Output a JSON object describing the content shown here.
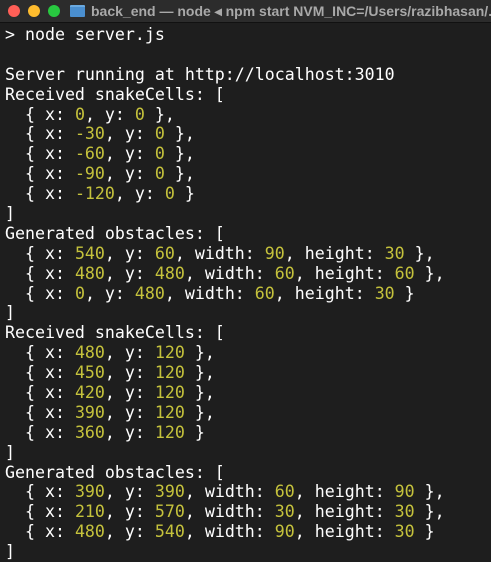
{
  "window": {
    "title": "back_end — node ◂ npm start NVM_INC=/Users/razibhasan/.nvm"
  },
  "colors": {
    "number": "#c5c23c",
    "text": "#ffffff",
    "background": "#1e1e1e"
  },
  "terminal": {
    "lines": [
      [
        {
          "t": "> node server.js"
        }
      ],
      [],
      [
        {
          "t": "Server running at http://localhost:3010"
        }
      ],
      [
        {
          "t": "Received snakeCells: ["
        }
      ],
      [
        {
          "t": "  { x: "
        },
        {
          "t": "0",
          "n": 1
        },
        {
          "t": ", y: "
        },
        {
          "t": "0",
          "n": 1
        },
        {
          "t": " },"
        }
      ],
      [
        {
          "t": "  { x: "
        },
        {
          "t": "-30",
          "n": 1
        },
        {
          "t": ", y: "
        },
        {
          "t": "0",
          "n": 1
        },
        {
          "t": " },"
        }
      ],
      [
        {
          "t": "  { x: "
        },
        {
          "t": "-60",
          "n": 1
        },
        {
          "t": ", y: "
        },
        {
          "t": "0",
          "n": 1
        },
        {
          "t": " },"
        }
      ],
      [
        {
          "t": "  { x: "
        },
        {
          "t": "-90",
          "n": 1
        },
        {
          "t": ", y: "
        },
        {
          "t": "0",
          "n": 1
        },
        {
          "t": " },"
        }
      ],
      [
        {
          "t": "  { x: "
        },
        {
          "t": "-120",
          "n": 1
        },
        {
          "t": ", y: "
        },
        {
          "t": "0",
          "n": 1
        },
        {
          "t": " }"
        }
      ],
      [
        {
          "t": "]"
        }
      ],
      [
        {
          "t": "Generated obstacles: ["
        }
      ],
      [
        {
          "t": "  { x: "
        },
        {
          "t": "540",
          "n": 1
        },
        {
          "t": ", y: "
        },
        {
          "t": "60",
          "n": 1
        },
        {
          "t": ", width: "
        },
        {
          "t": "90",
          "n": 1
        },
        {
          "t": ", height: "
        },
        {
          "t": "30",
          "n": 1
        },
        {
          "t": " },"
        }
      ],
      [
        {
          "t": "  { x: "
        },
        {
          "t": "480",
          "n": 1
        },
        {
          "t": ", y: "
        },
        {
          "t": "480",
          "n": 1
        },
        {
          "t": ", width: "
        },
        {
          "t": "60",
          "n": 1
        },
        {
          "t": ", height: "
        },
        {
          "t": "60",
          "n": 1
        },
        {
          "t": " },"
        }
      ],
      [
        {
          "t": "  { x: "
        },
        {
          "t": "0",
          "n": 1
        },
        {
          "t": ", y: "
        },
        {
          "t": "480",
          "n": 1
        },
        {
          "t": ", width: "
        },
        {
          "t": "60",
          "n": 1
        },
        {
          "t": ", height: "
        },
        {
          "t": "30",
          "n": 1
        },
        {
          "t": " }"
        }
      ],
      [
        {
          "t": "]"
        }
      ],
      [
        {
          "t": "Received snakeCells: ["
        }
      ],
      [
        {
          "t": "  { x: "
        },
        {
          "t": "480",
          "n": 1
        },
        {
          "t": ", y: "
        },
        {
          "t": "120",
          "n": 1
        },
        {
          "t": " },"
        }
      ],
      [
        {
          "t": "  { x: "
        },
        {
          "t": "450",
          "n": 1
        },
        {
          "t": ", y: "
        },
        {
          "t": "120",
          "n": 1
        },
        {
          "t": " },"
        }
      ],
      [
        {
          "t": "  { x: "
        },
        {
          "t": "420",
          "n": 1
        },
        {
          "t": ", y: "
        },
        {
          "t": "120",
          "n": 1
        },
        {
          "t": " },"
        }
      ],
      [
        {
          "t": "  { x: "
        },
        {
          "t": "390",
          "n": 1
        },
        {
          "t": ", y: "
        },
        {
          "t": "120",
          "n": 1
        },
        {
          "t": " },"
        }
      ],
      [
        {
          "t": "  { x: "
        },
        {
          "t": "360",
          "n": 1
        },
        {
          "t": ", y: "
        },
        {
          "t": "120",
          "n": 1
        },
        {
          "t": " }"
        }
      ],
      [
        {
          "t": "]"
        }
      ],
      [
        {
          "t": "Generated obstacles: ["
        }
      ],
      [
        {
          "t": "  { x: "
        },
        {
          "t": "390",
          "n": 1
        },
        {
          "t": ", y: "
        },
        {
          "t": "390",
          "n": 1
        },
        {
          "t": ", width: "
        },
        {
          "t": "60",
          "n": 1
        },
        {
          "t": ", height: "
        },
        {
          "t": "90",
          "n": 1
        },
        {
          "t": " },"
        }
      ],
      [
        {
          "t": "  { x: "
        },
        {
          "t": "210",
          "n": 1
        },
        {
          "t": ", y: "
        },
        {
          "t": "570",
          "n": 1
        },
        {
          "t": ", width: "
        },
        {
          "t": "30",
          "n": 1
        },
        {
          "t": ", height: "
        },
        {
          "t": "30",
          "n": 1
        },
        {
          "t": " },"
        }
      ],
      [
        {
          "t": "  { x: "
        },
        {
          "t": "480",
          "n": 1
        },
        {
          "t": ", y: "
        },
        {
          "t": "540",
          "n": 1
        },
        {
          "t": ", width: "
        },
        {
          "t": "90",
          "n": 1
        },
        {
          "t": ", height: "
        },
        {
          "t": "30",
          "n": 1
        },
        {
          "t": " }"
        }
      ],
      [
        {
          "t": "]"
        }
      ]
    ]
  }
}
